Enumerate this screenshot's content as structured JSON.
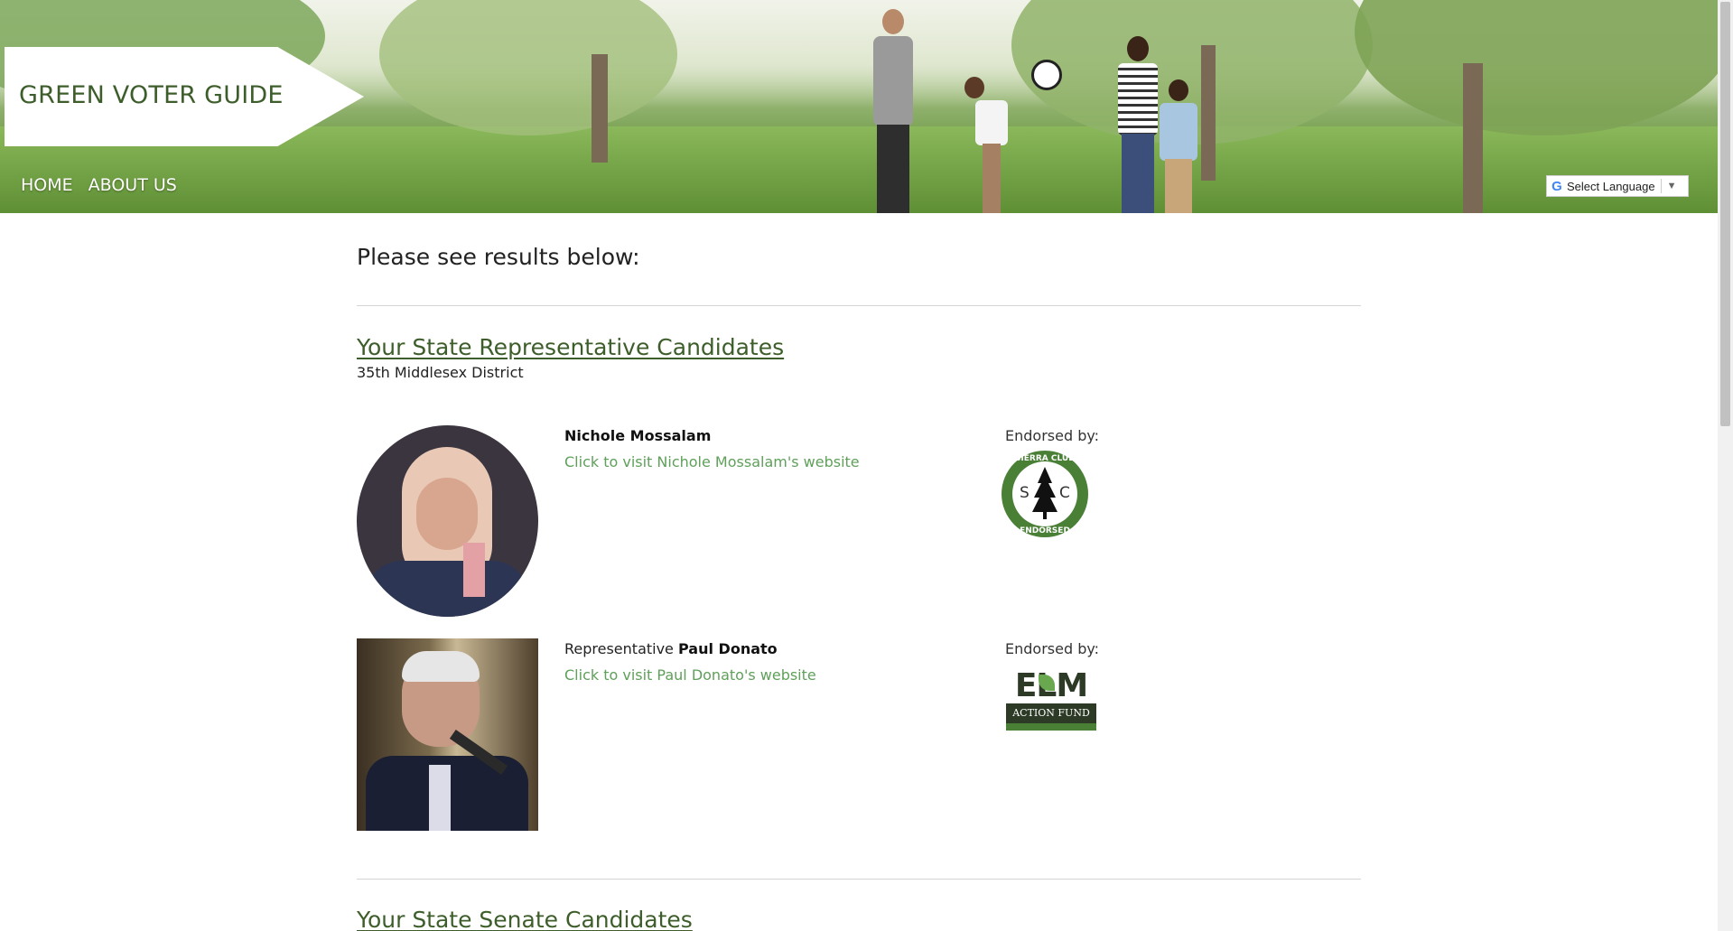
{
  "header": {
    "logo_text": "GREEN VOTER GUIDE",
    "nav": [
      {
        "label": "HOME"
      },
      {
        "label": "ABOUT US"
      }
    ],
    "language_selector": {
      "label": "Select Language",
      "icon": "google-g-icon",
      "arrow": "▼"
    }
  },
  "main": {
    "intro": "Please see results below:",
    "sections": [
      {
        "title": "Your State Representative Candidates",
        "district": "35th Middlesex District",
        "candidates": [
          {
            "prefix": "",
            "name": "Nichole Mossalam",
            "link_text": "Click to visit Nichole Mossalam's website",
            "endorsed_label": "Endorsed by:",
            "endorser": "Sierra Club",
            "endorser_logo_text": {
              "top": "SIERRA CLUB",
              "left": "S",
              "right": "C",
              "bottom": "ENDORSED"
            }
          },
          {
            "prefix": "Representative",
            "name": "Paul Donato",
            "link_text": "Click to visit Paul Donato's website",
            "endorsed_label": "Endorsed by:",
            "endorser": "ELM Action Fund",
            "endorser_logo_text": {
              "main": "ELM",
              "sub": "ACTION FUND"
            }
          }
        ]
      },
      {
        "title": "Your State Senate Candidates"
      }
    ]
  },
  "colors": {
    "brand_green": "#3d5e2a",
    "link_green": "#5fa05a",
    "sierra_green": "#4a7f36",
    "elm_dark": "#2c3a26"
  }
}
